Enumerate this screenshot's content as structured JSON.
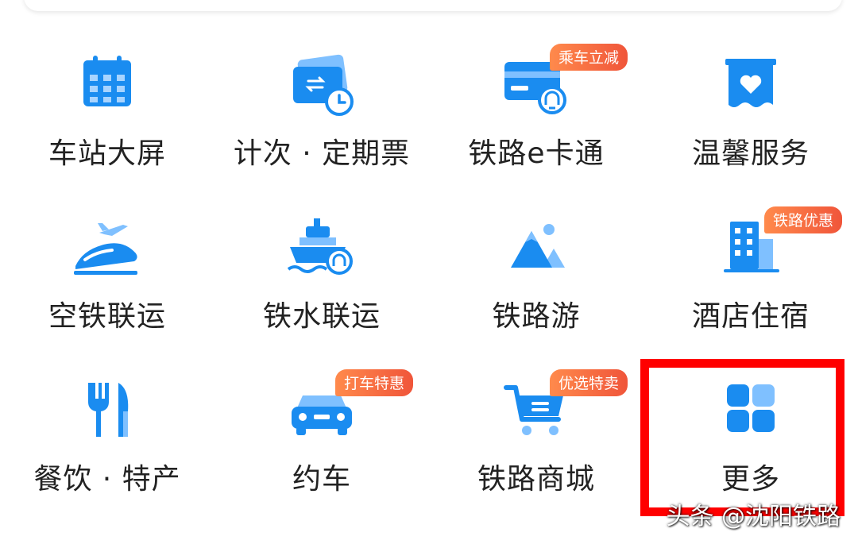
{
  "colors": {
    "primary": "#1a8cf0",
    "light": "#7fc0ff",
    "badge_start": "#ff8a4c",
    "badge_end": "#f0553a",
    "highlight": "#ff0000"
  },
  "tiles": [
    {
      "label": "车站大屏",
      "icon": "calendar-icon"
    },
    {
      "label": "计次 · 定期票",
      "icon": "ticket-clock-icon"
    },
    {
      "label": "铁路e卡通",
      "icon": "rail-card-icon",
      "badge": "乘车立减"
    },
    {
      "label": "温馨服务",
      "icon": "heart-box-icon"
    },
    {
      "label": "空铁联运",
      "icon": "plane-train-icon"
    },
    {
      "label": "铁水联运",
      "icon": "ship-train-icon"
    },
    {
      "label": "铁路游",
      "icon": "mountain-icon"
    },
    {
      "label": "酒店住宿",
      "icon": "hotel-icon",
      "badge": "铁路优惠"
    },
    {
      "label": "餐饮 · 特产",
      "icon": "fork-knife-icon"
    },
    {
      "label": "约车",
      "icon": "car-icon",
      "badge": "打车特惠"
    },
    {
      "label": "铁路商城",
      "icon": "shopping-cart-icon",
      "badge": "优选特卖"
    },
    {
      "label": "更多",
      "icon": "more-grid-icon"
    }
  ],
  "watermark": "头条 @沈阳铁路"
}
